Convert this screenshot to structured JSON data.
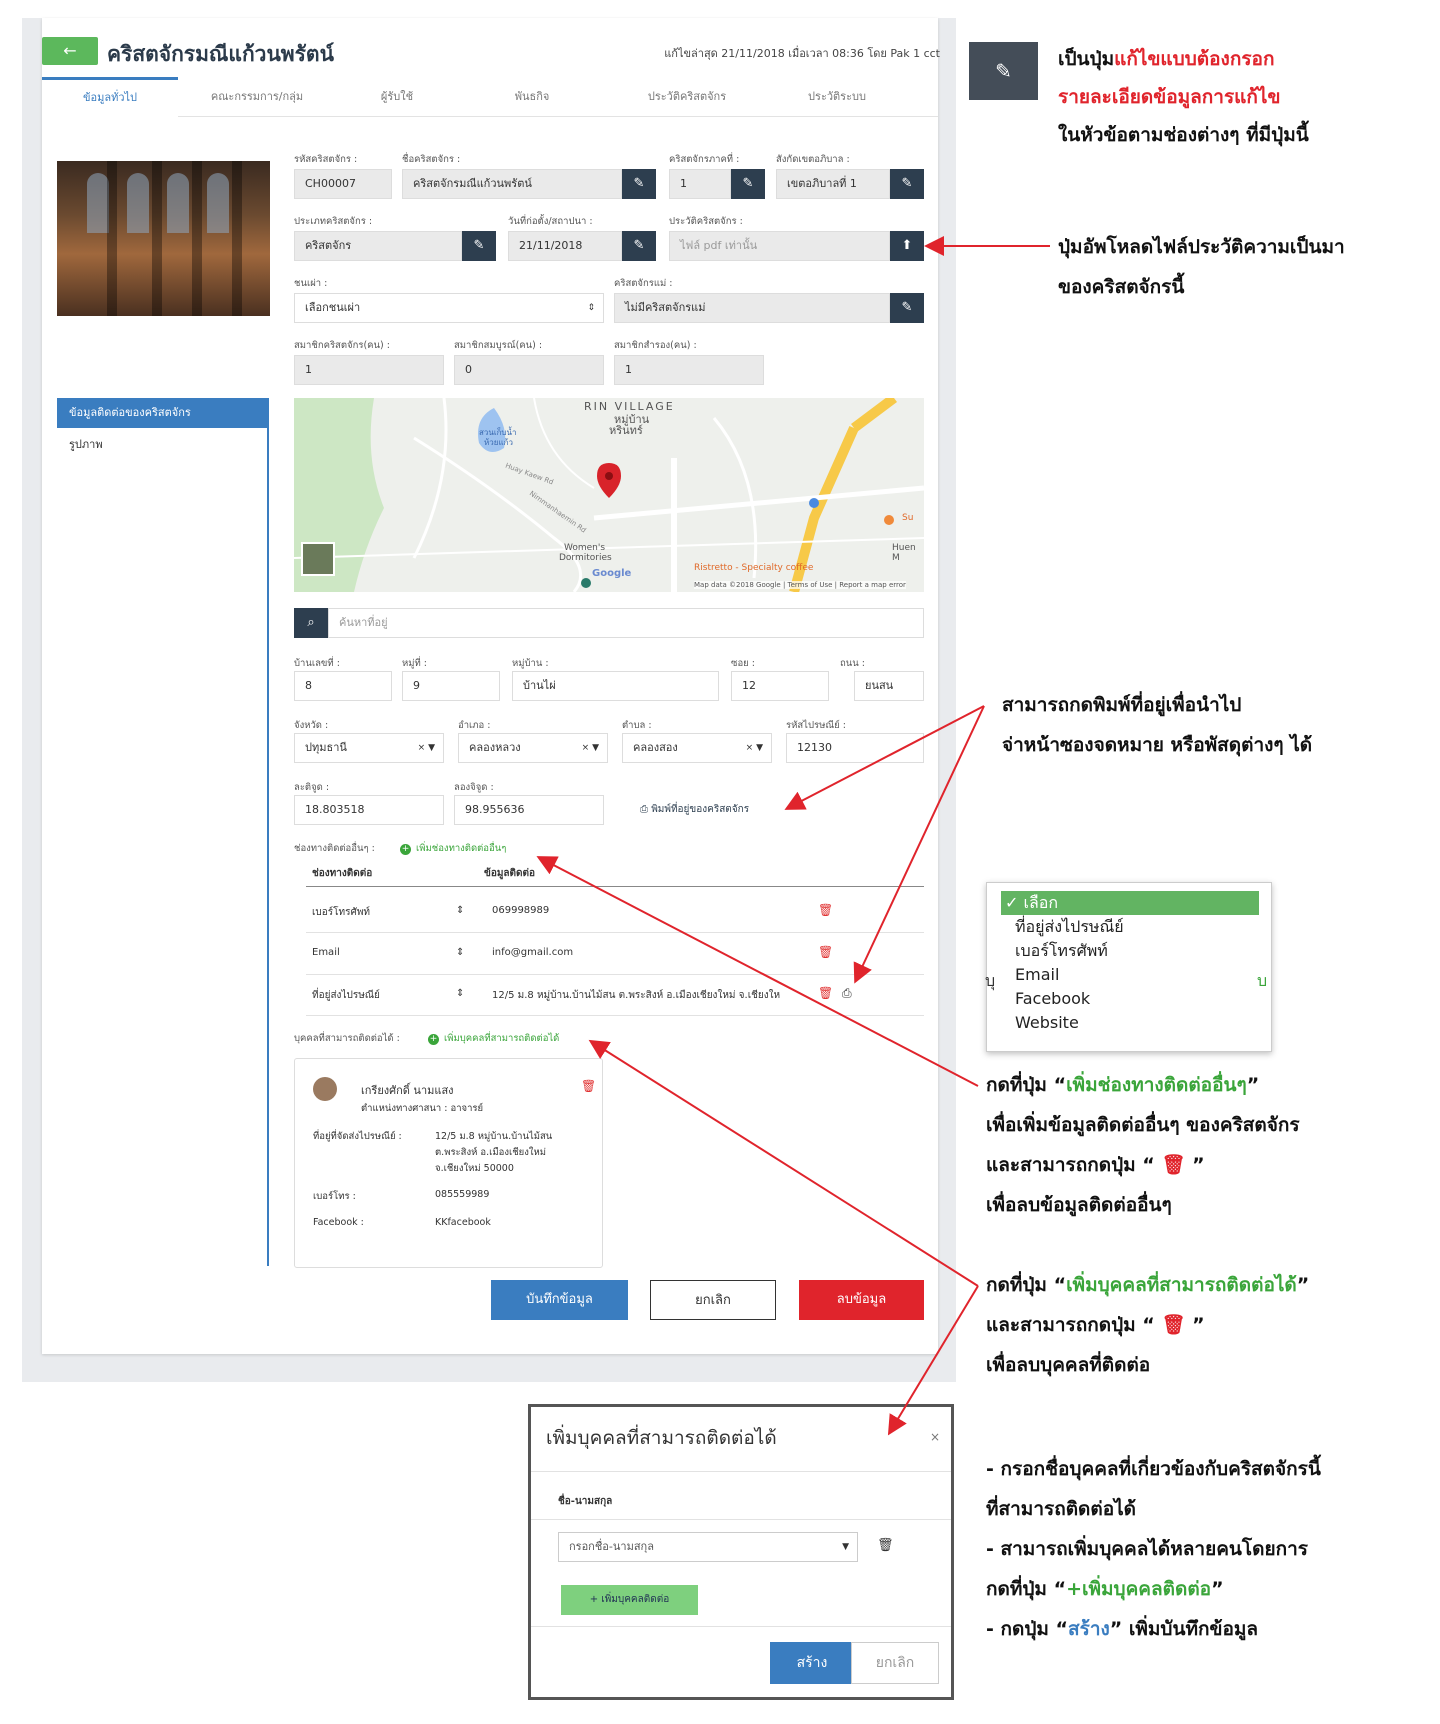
{
  "header": {
    "back_label": "←",
    "title": "คริสตจักรมณีแก้วนพรัตน์",
    "last_edit": "แก้ไขล่าสุด 21/11/2018 เมื่อเวลา 08:36 โดย Pak 1 cct"
  },
  "tabs": [
    "ข้อมูลทั่วไป",
    "คณะกรรมการ/กลุ่ม",
    "ผู้รับใช้",
    "พันธกิจ",
    "ประวัติคริสตจักร",
    "ประวัติระบบ"
  ],
  "side_menu": [
    "ข้อมูลติดต่อของคริสตจักร",
    "รูปภาพ"
  ],
  "form": {
    "code_label": "รหัสคริสตจักร :",
    "code_value": "CH00007",
    "name_label": "ชื่อคริสตจักร :",
    "name_value": "คริสตจักรมณีแก้วนพรัตน์",
    "region_label": "คริสตจักรภาคที่ :",
    "region_value": "1",
    "district_label": "สังกัดเขตอภิบาล :",
    "district_value": "เขตอภิบาลที่ 1",
    "type_label": "ประเภทคริสตจักร :",
    "type_value": "คริสตจักร",
    "founded_label": "วันที่ก่อตั้ง/สถาปนา :",
    "founded_value": "21/11/2018",
    "history_label": "ประวัติคริสตจักร :",
    "history_placeholder": "ไฟล์ pdf เท่านั้น",
    "tribe_label": "ชนเผ่า :",
    "tribe_value": "เลือกชนเผ่า",
    "mother_label": "คริสตจักรแม่ :",
    "mother_value": "ไม่มีคริสตจักรแม่",
    "members_label": "สมาชิกคริสตจักร(คน) :",
    "members_value": "1",
    "full_members_label": "สมาชิกสมบูรณ์(คน) :",
    "full_members_value": "0",
    "reserve_members_label": "สมาชิกสำรอง(คน) :",
    "reserve_members_value": "1"
  },
  "map": {
    "labels": [
      "RIN VILLAGE",
      "หมู่บ้าน",
      "หรินทร์",
      "สวนเก็บน้ำ",
      "ห้วยแก้ว",
      "Women's",
      "Dormitories",
      "Ristretto - Specialty coffee",
      "Huen M",
      "Su",
      "Map data ©2018 Google | Terms of Use | Report a map error",
      "Google",
      "Nimmanhaemin Rd",
      "Huay Kaew Rd"
    ]
  },
  "search": {
    "placeholder": "ค้นหาที่อยู่"
  },
  "address": {
    "house_no_label": "บ้านเลขที่ :",
    "house_no": "8",
    "moo_label": "หมู่ที่ :",
    "moo": "9",
    "village_label": "หมู่บ้าน :",
    "village": "บ้านไผ่",
    "soi_label": "ซอย :",
    "soi": "12",
    "road_label": "ถนน :",
    "road": "ยนสน",
    "province_label": "จังหวัด :",
    "province": "ปทุมธานี",
    "amphoe_label": "อำเภอ :",
    "amphoe": "คลองหลวง",
    "tambon_label": "ตำบล :",
    "tambon": "คลองสอง",
    "postcode_label": "รหัสไปรษณีย์ :",
    "postcode": "12130",
    "lat_label": "ละติจูด :",
    "lat": "18.803518",
    "lng_label": "ลองจิจูด :",
    "lng": "98.955636",
    "print_label": "พิมพ์ที่อยู่ของคริสตจักร"
  },
  "contacts": {
    "label": "ช่องทางติดต่ออื่นๆ :",
    "add_label": "เพิ่มช่องทางติดต่ออื่นๆ",
    "col_channel": "ช่องทางติดต่อ",
    "col_info": "ข้อมูลติดต่อ",
    "rows": [
      {
        "channel": "เบอร์โทรศัพท์",
        "info": "069998989"
      },
      {
        "channel": "Email",
        "info": "info@gmail.com"
      },
      {
        "channel": "ที่อยู่ส่งไปรษณีย์",
        "info": "12/5 ม.8 หมู่บ้าน.บ้านไม้สน ต.พระสิงห์ อ.เมืองเชียงใหม่ จ.เชียงให"
      }
    ]
  },
  "persons": {
    "label": "บุคคลที่สามารถติดต่อได้ :",
    "add_label": "เพิ่มบุคคลที่สามารถติดต่อได้",
    "card": {
      "name": "เกรียงศักดิ์ นามแสง",
      "position": "ตำแหน่งทางศาสนา : อาจารย์",
      "address_label": "ที่อยู่ที่จัดส่งไปรษณีย์ :",
      "address_1": "12/5 ม.8 หมู่บ้าน.บ้านไม้สน",
      "address_2": "ต.พระสิงห์ อ.เมืองเชียงใหม่",
      "address_3": "จ.เชียงใหม่ 50000",
      "phone_label": "เบอร์โทร :",
      "phone": "085559989",
      "facebook_label": "Facebook :",
      "facebook": "KKfacebook"
    }
  },
  "actions": {
    "save": "บันทึกข้อมูล",
    "cancel": "ยกเลิก",
    "delete": "ลบข้อมูล"
  },
  "dropdown": {
    "partial_left": "บุ",
    "partial_right": "บ",
    "options": [
      "✓ เลือก",
      "ที่อยู่ส่งไปรษณีย์",
      "เบอร์โทรศัพท์",
      "Email",
      "Facebook",
      "Website"
    ]
  },
  "modal": {
    "title": "เพิ่มบุคคลที่สามารถติดต่อได้",
    "close": "×",
    "name_label": "ชื่อ-นามสกุล",
    "name_placeholder": "กรอกชื่อ-นามสกุล",
    "add_person": "+ เพิ่มบุคคลติดต่อ",
    "create": "สร้าง",
    "cancel": "ยกเลิก"
  },
  "annotations": {
    "edit_1a": "เป็นปุ่ม",
    "edit_1b": "แก้ไขแบบต้องกรอก",
    "edit_2": "รายละเอียดข้อมูลการแก้ไข",
    "edit_3": "ในหัวข้อตามช่องต่างๆ ที่มีปุ่มนี้",
    "upload_1": "ปุ่มอัพโหลดไฟล์ประวัติความเป็นมา",
    "upload_2": "ของคริสตจักรนี้",
    "print_1": "สามารถกดพิมพ์ที่อยู่เพื่อนำไป",
    "print_2": "จ่าหน้าซองจดหมาย หรือพัสดุต่างๆ ได้",
    "contact_1a": "กดที่ปุ่ม “",
    "contact_1b": "เพิ่มช่องทางติดต่ออื่นๆ",
    "contact_1c": "”",
    "contact_2": "เพื่อเพิ่มข้อมูลติดต่ออื่นๆ ของคริสตจักร",
    "contact_3a": "และสามารถกดปุ่ม “ ",
    "contact_3c": " ”",
    "contact_4": "เพื่อลบข้อมูลติดต่ออื่นๆ",
    "person_1a": "กดที่ปุ่ม “",
    "person_1b": "เพิ่มบุคคลที่สามารถติดต่อได้",
    "person_1c": "”",
    "person_2a": "และสามารถกดปุ่ม “ ",
    "person_2c": " ”",
    "person_3": "เพื่อลบบุคคลที่ติดต่อ",
    "modal_1": "- กรอกชื่อบุคคลที่เกี่ยวข้องกับคริสตจักรนี้",
    "modal_2": "  ที่สามารถติดต่อได้",
    "modal_3": "- สามารถเพิ่มบุคคลได้หลายคนโดยการ",
    "modal_4a": "  กดที่ปุ่ม “",
    "modal_4b": "+เพิ่มบุคคลติดต่อ",
    "modal_4c": "”",
    "modal_5a": "- กดปุ่ม “",
    "modal_5b": "สร้าง",
    "modal_5c": "” เพิ่มบันทึกข้อมูล"
  },
  "icons": {
    "edit": "edit-icon",
    "upload": "upload-icon",
    "search": "search-icon",
    "trash": "trash-icon",
    "print": "print-icon",
    "map_pin": "map-pin-icon"
  },
  "colors": {
    "primary": "#3a7dc0",
    "success": "#3aa53a",
    "danger": "#e0242c",
    "dark_button": "#2d3e4f"
  }
}
